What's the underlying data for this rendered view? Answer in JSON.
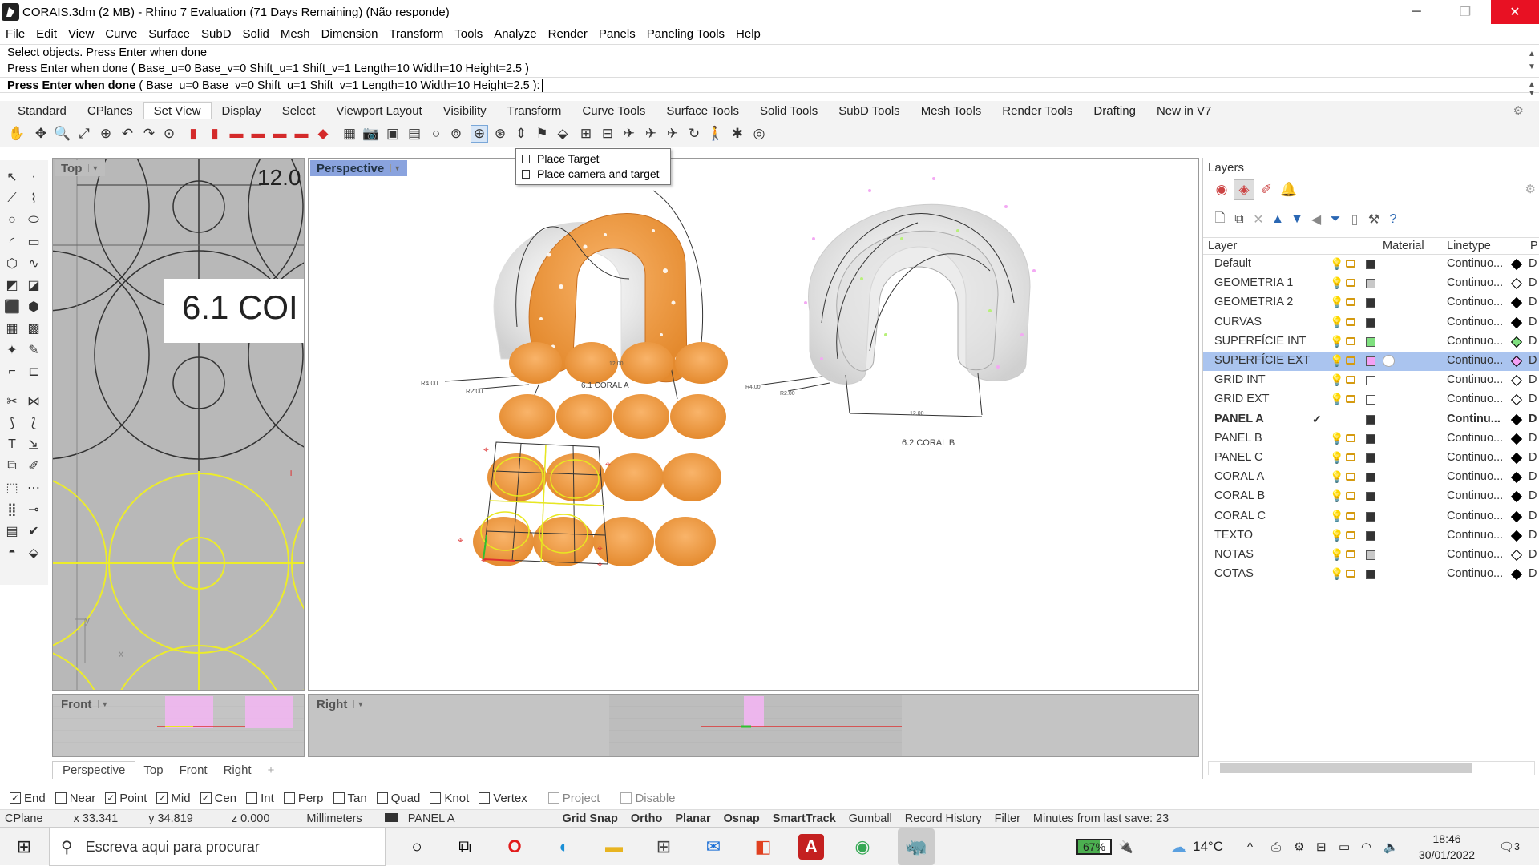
{
  "window": {
    "title": "CORAIS.3dm (2 MB) - Rhino 7 Evaluation (71 Days Remaining) (Não responde)",
    "minimize": "─",
    "maximize": "❐",
    "close": "✕"
  },
  "menu": [
    "File",
    "Edit",
    "View",
    "Curve",
    "Surface",
    "SubD",
    "Solid",
    "Mesh",
    "Dimension",
    "Transform",
    "Tools",
    "Analyze",
    "Render",
    "Panels",
    "Paneling Tools",
    "Help"
  ],
  "command": {
    "line1": "Select objects. Press Enter when done",
    "line2": "Press Enter when done ( Base_u=0  Base_v=0  Shift_u=1  Shift_v=1  Length=10  Width=10  Height=2.5 )",
    "prompt_bold": "Press Enter when done",
    "prompt_rest": " ( Base_u=0  Base_v=0  Shift_u=1  Shift_v=1  Length=10  Width=10  Height=2.5 ):"
  },
  "tabs": [
    "Standard",
    "CPlanes",
    "Set View",
    "Display",
    "Select",
    "Viewport Layout",
    "Visibility",
    "Transform",
    "Curve Tools",
    "Surface Tools",
    "Solid Tools",
    "SubD Tools",
    "Mesh Tools",
    "Render Tools",
    "Drafting",
    "New in V7"
  ],
  "tooltip": {
    "item1": "Place Target",
    "item2": "Place camera and target"
  },
  "viewports": {
    "top": {
      "label": "Top",
      "big_text": "6.1 COI",
      "dim_text": "12.0"
    },
    "perspective": {
      "label": "Perspective",
      "coral_a": "6.1 CORAL A",
      "coral_b": "6.2 CORAL B",
      "dim1": "R4.00",
      "dim2": "R2.00",
      "dim3": "12.00",
      "dim4": "R4.00",
      "dim5": "R2.00",
      "dim6": "12.00"
    },
    "front": {
      "label": "Front"
    },
    "right": {
      "label": "Right"
    }
  },
  "viewport_tabs": [
    "Perspective",
    "Top",
    "Front",
    "Right",
    "+"
  ],
  "layers_panel": {
    "title": "Layers",
    "columns": {
      "layer": "Layer",
      "material": "Material",
      "linetype": "Linetype",
      "print": "P"
    },
    "rows": [
      {
        "name": "Default",
        "color": "#333333",
        "linetype": "Continuo...",
        "p": "D"
      },
      {
        "name": "GEOMETRIA 1",
        "color": "#c8c8c8",
        "linetype": "Continuo...",
        "p": "D"
      },
      {
        "name": "GEOMETRIA 2",
        "color": "#333333",
        "linetype": "Continuo...",
        "p": "D"
      },
      {
        "name": "CURVAS",
        "color": "#333333",
        "linetype": "Continuo...",
        "p": "D"
      },
      {
        "name": "SUPERFÍCIE INT",
        "color": "#7fe07f",
        "linetype": "Continuo...",
        "p": "D"
      },
      {
        "name": "SUPERFÍCIE EXT",
        "color": "#f4a0f4",
        "linetype": "Continuo...",
        "p": "D"
      },
      {
        "name": "GRID INT",
        "color": "#ffffff",
        "linetype": "Continuo...",
        "p": "D"
      },
      {
        "name": "GRID EXT",
        "color": "#ffffff",
        "linetype": "Continuo...",
        "p": "D"
      },
      {
        "name": "PANEL A",
        "color": "#333333",
        "linetype": "Continu...",
        "p": "D",
        "current": "✓"
      },
      {
        "name": "PANEL B",
        "color": "#333333",
        "linetype": "Continuo...",
        "p": "D"
      },
      {
        "name": "PANEL C",
        "color": "#333333",
        "linetype": "Continuo...",
        "p": "D"
      },
      {
        "name": "CORAL A",
        "color": "#333333",
        "linetype": "Continuo...",
        "p": "D"
      },
      {
        "name": "CORAL B",
        "color": "#333333",
        "linetype": "Continuo...",
        "p": "D"
      },
      {
        "name": "CORAL C",
        "color": "#333333",
        "linetype": "Continuo...",
        "p": "D"
      },
      {
        "name": "TEXTO",
        "color": "#333333",
        "linetype": "Continuo...",
        "p": "D"
      },
      {
        "name": "NOTAS",
        "color": "#c8c8c8",
        "linetype": "Continuo...",
        "p": "D"
      },
      {
        "name": "COTAS",
        "color": "#333333",
        "linetype": "Continuo...",
        "p": "D"
      }
    ]
  },
  "osnap": [
    {
      "label": "End",
      "checked": true
    },
    {
      "label": "Near",
      "checked": false
    },
    {
      "label": "Point",
      "checked": true
    },
    {
      "label": "Mid",
      "checked": true
    },
    {
      "label": "Cen",
      "checked": true
    },
    {
      "label": "Int",
      "checked": false
    },
    {
      "label": "Perp",
      "checked": false
    },
    {
      "label": "Tan",
      "checked": false
    },
    {
      "label": "Quad",
      "checked": false
    },
    {
      "label": "Knot",
      "checked": false
    },
    {
      "label": "Vertex",
      "checked": false
    },
    {
      "label": "Project",
      "checked": false,
      "disabled": true
    },
    {
      "label": "Disable",
      "checked": false,
      "disabled": true
    }
  ],
  "status": {
    "cplane": "CPlane",
    "x": "x 33.341",
    "y": "y 34.819",
    "z": "z 0.000",
    "units": "Millimeters",
    "layer": "PANEL A",
    "grid_snap": "Grid Snap",
    "ortho": "Ortho",
    "planar": "Planar",
    "osnap": "Osnap",
    "smarttrack": "SmartTrack",
    "gumball": "Gumball",
    "record": "Record History",
    "filter": "Filter",
    "minutes": "Minutes from last save: 23"
  },
  "taskbar": {
    "search_placeholder": "Escreva aqui para procurar",
    "battery": "67%",
    "weather": "14°C",
    "time": "18:46",
    "date": "30/01/2022",
    "notifications": "3"
  },
  "colors": {
    "accent": "#8aa3de",
    "layer_selected": "#aac4ef",
    "coral_orange": "#f6a050"
  }
}
